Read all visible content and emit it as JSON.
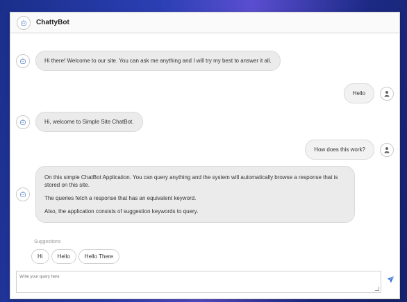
{
  "app": {
    "title": "ChattyBot"
  },
  "messages": [
    {
      "sender": "bot",
      "text": "Hi there! Welcome to our site.  You can ask me anything and I will try my best to answer it all."
    },
    {
      "sender": "user",
      "text": "Hello"
    },
    {
      "sender": "bot",
      "text": "Hi, welcome to Simple Site ChatBot."
    },
    {
      "sender": "user",
      "text": "How does this work?"
    },
    {
      "sender": "bot",
      "lines": [
        "On this simple ChatBot Application. You can query anything and the system will automatically browse a response that is stored on this site.",
        "The queries fetch a response that has an equivalent keyword.",
        "Also, the application consists of suggestion keywords to query."
      ]
    }
  ],
  "suggestions": {
    "label": "Suggestions",
    "items": [
      "Hi",
      "Hello",
      "Hello There"
    ]
  },
  "input": {
    "placeholder": "Write your query here",
    "value": ""
  },
  "icons": {
    "bot": "bot-face-icon",
    "user": "user-person-icon",
    "send": "paper-plane-icon"
  },
  "colors": {
    "accent": "#2e6fd8",
    "bubble": "#ebebeb"
  }
}
